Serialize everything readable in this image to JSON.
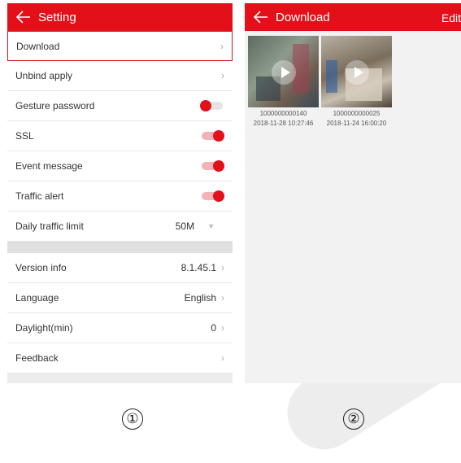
{
  "colors": {
    "accent": "#e3101a",
    "toggle_track_on": "#f3b3b6"
  },
  "setting_screen": {
    "title": "Setting",
    "rows": {
      "download": {
        "label": "Download"
      },
      "unbind": {
        "label": "Unbind apply"
      },
      "gesture": {
        "label": "Gesture password",
        "toggle": false
      },
      "ssl": {
        "label": "SSL",
        "toggle": true
      },
      "event": {
        "label": "Event message",
        "toggle": true
      },
      "traffic": {
        "label": "Traffic alert",
        "toggle": true
      },
      "daily": {
        "label": "Daily traffic limit",
        "value": "50M"
      },
      "version": {
        "label": "Version info",
        "value": "8.1.45.1"
      },
      "language": {
        "label": "Language",
        "value": "English"
      },
      "daylight": {
        "label": "Daylight(min)",
        "value": "0"
      },
      "feedback": {
        "label": "Feedback"
      }
    }
  },
  "download_screen": {
    "title": "Download",
    "edit_label": "Edit",
    "items": [
      {
        "name": "1000000000140",
        "date": "2018-11-28 10:27:46"
      },
      {
        "name": "1000000000025",
        "date": "2018-11-24 16:00:20"
      }
    ]
  },
  "markers": {
    "first": "①",
    "second": "②"
  },
  "icons": {
    "back": "back-arrow-icon",
    "chevron": "chevron-right-icon",
    "play": "play-icon",
    "dropdown": "dropdown-triangle-icon"
  }
}
